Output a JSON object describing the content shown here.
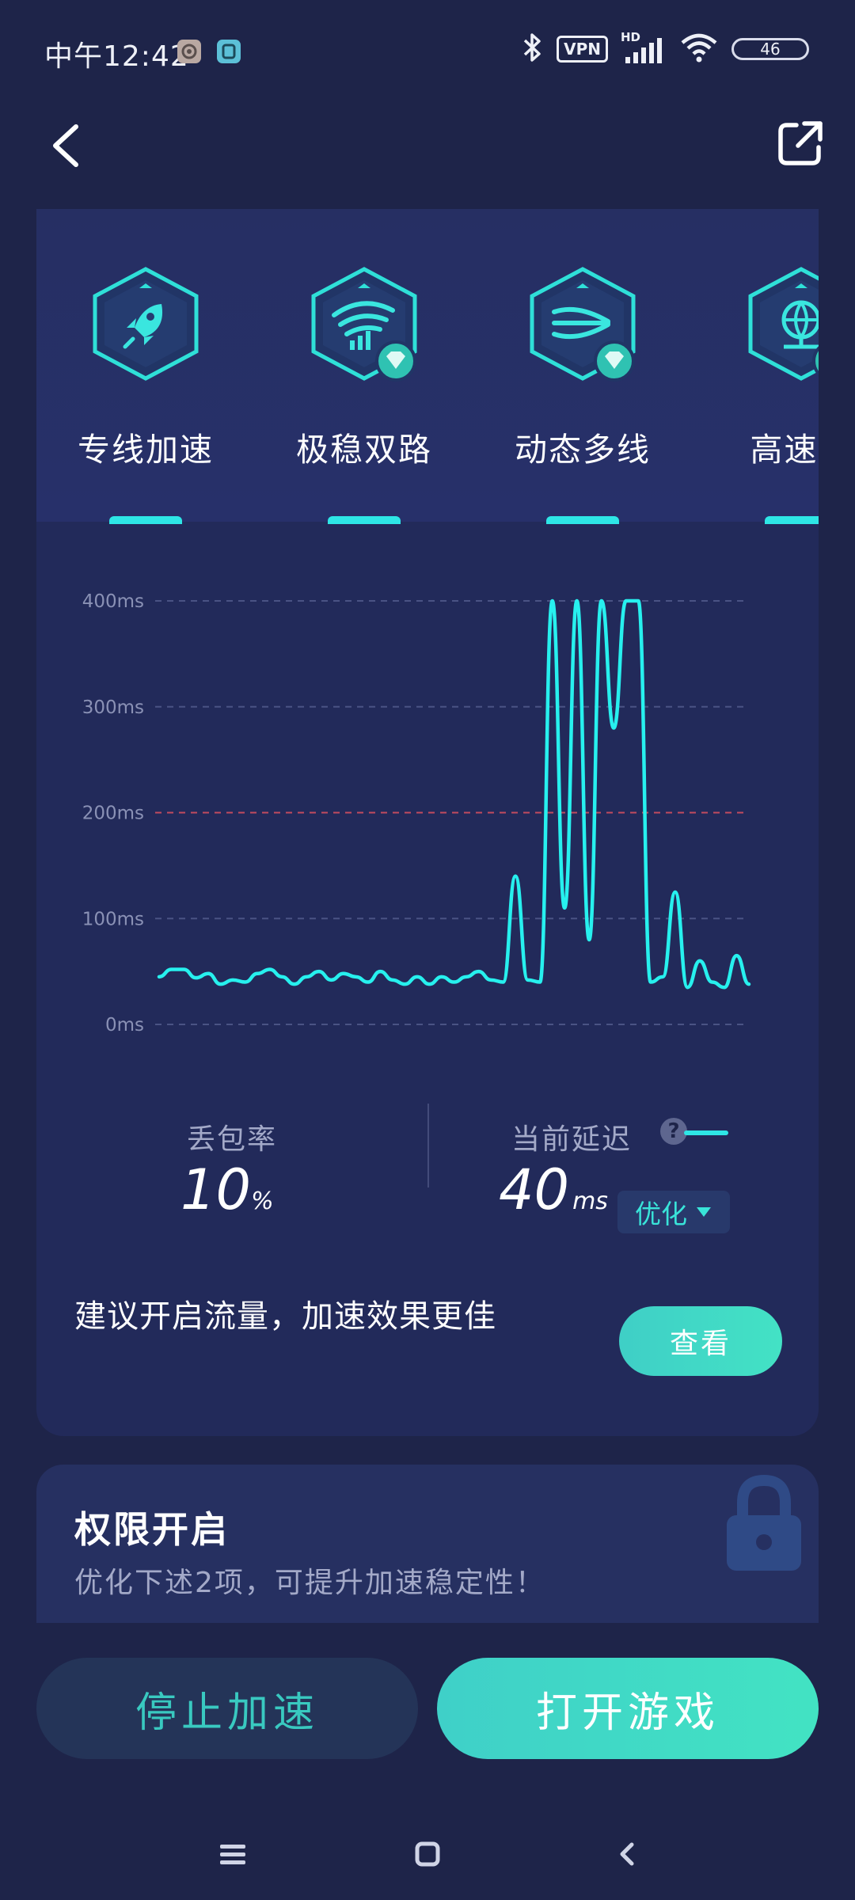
{
  "status_bar": {
    "time": "中午12:42",
    "vpn": "VPN",
    "hd": "HD",
    "battery": "46"
  },
  "tabs": [
    {
      "label": "专线加速",
      "icon": "rocket-icon",
      "premium": false
    },
    {
      "label": "极稳双路",
      "icon": "dual-wifi-icon",
      "premium": true
    },
    {
      "label": "动态多线",
      "icon": "multi-line-icon",
      "premium": true
    },
    {
      "label": "高速专",
      "icon": "globe-network-icon",
      "premium": true
    }
  ],
  "chart_data": {
    "type": "line",
    "y_tick_labels": [
      "400ms",
      "300ms",
      "200ms",
      "100ms",
      "0ms"
    ],
    "ylim": [
      0,
      400
    ],
    "unit": "ms",
    "grid": true,
    "threshold": 200,
    "series": [
      {
        "color": "#27f0ee",
        "values": [
          45,
          52,
          52,
          44,
          48,
          38,
          42,
          40,
          48,
          52,
          45,
          38,
          45,
          50,
          42,
          48,
          45,
          40,
          50,
          42,
          38,
          45,
          38,
          45,
          40,
          45,
          50,
          42,
          40,
          140,
          42,
          40,
          400,
          110,
          400,
          80,
          400,
          280,
          400,
          400,
          40,
          45,
          125,
          35,
          60,
          40,
          35,
          65,
          38
        ]
      }
    ]
  },
  "stats": {
    "loss_label": "丢包率",
    "loss_value": "10",
    "loss_unit": "%",
    "latency_label": "当前延迟",
    "latency_value": "40",
    "latency_unit": "ms",
    "optimize_label": "优化"
  },
  "tip": {
    "text": "建议开启流量，加速效果更佳",
    "button": "查看"
  },
  "permission": {
    "title": "权限开启",
    "subtitle": "优化下述2项，可提升加速稳定性！"
  },
  "actions": {
    "stop": "停止加速",
    "open": "打开游戏"
  },
  "colors": {
    "accent": "#2ee6e6",
    "button_gradient_start": "#3fd0c8",
    "button_gradient_end": "#42e3c3",
    "background": "#1e2449",
    "card": "#222a5a",
    "threshold_line": "#c24b5f"
  }
}
